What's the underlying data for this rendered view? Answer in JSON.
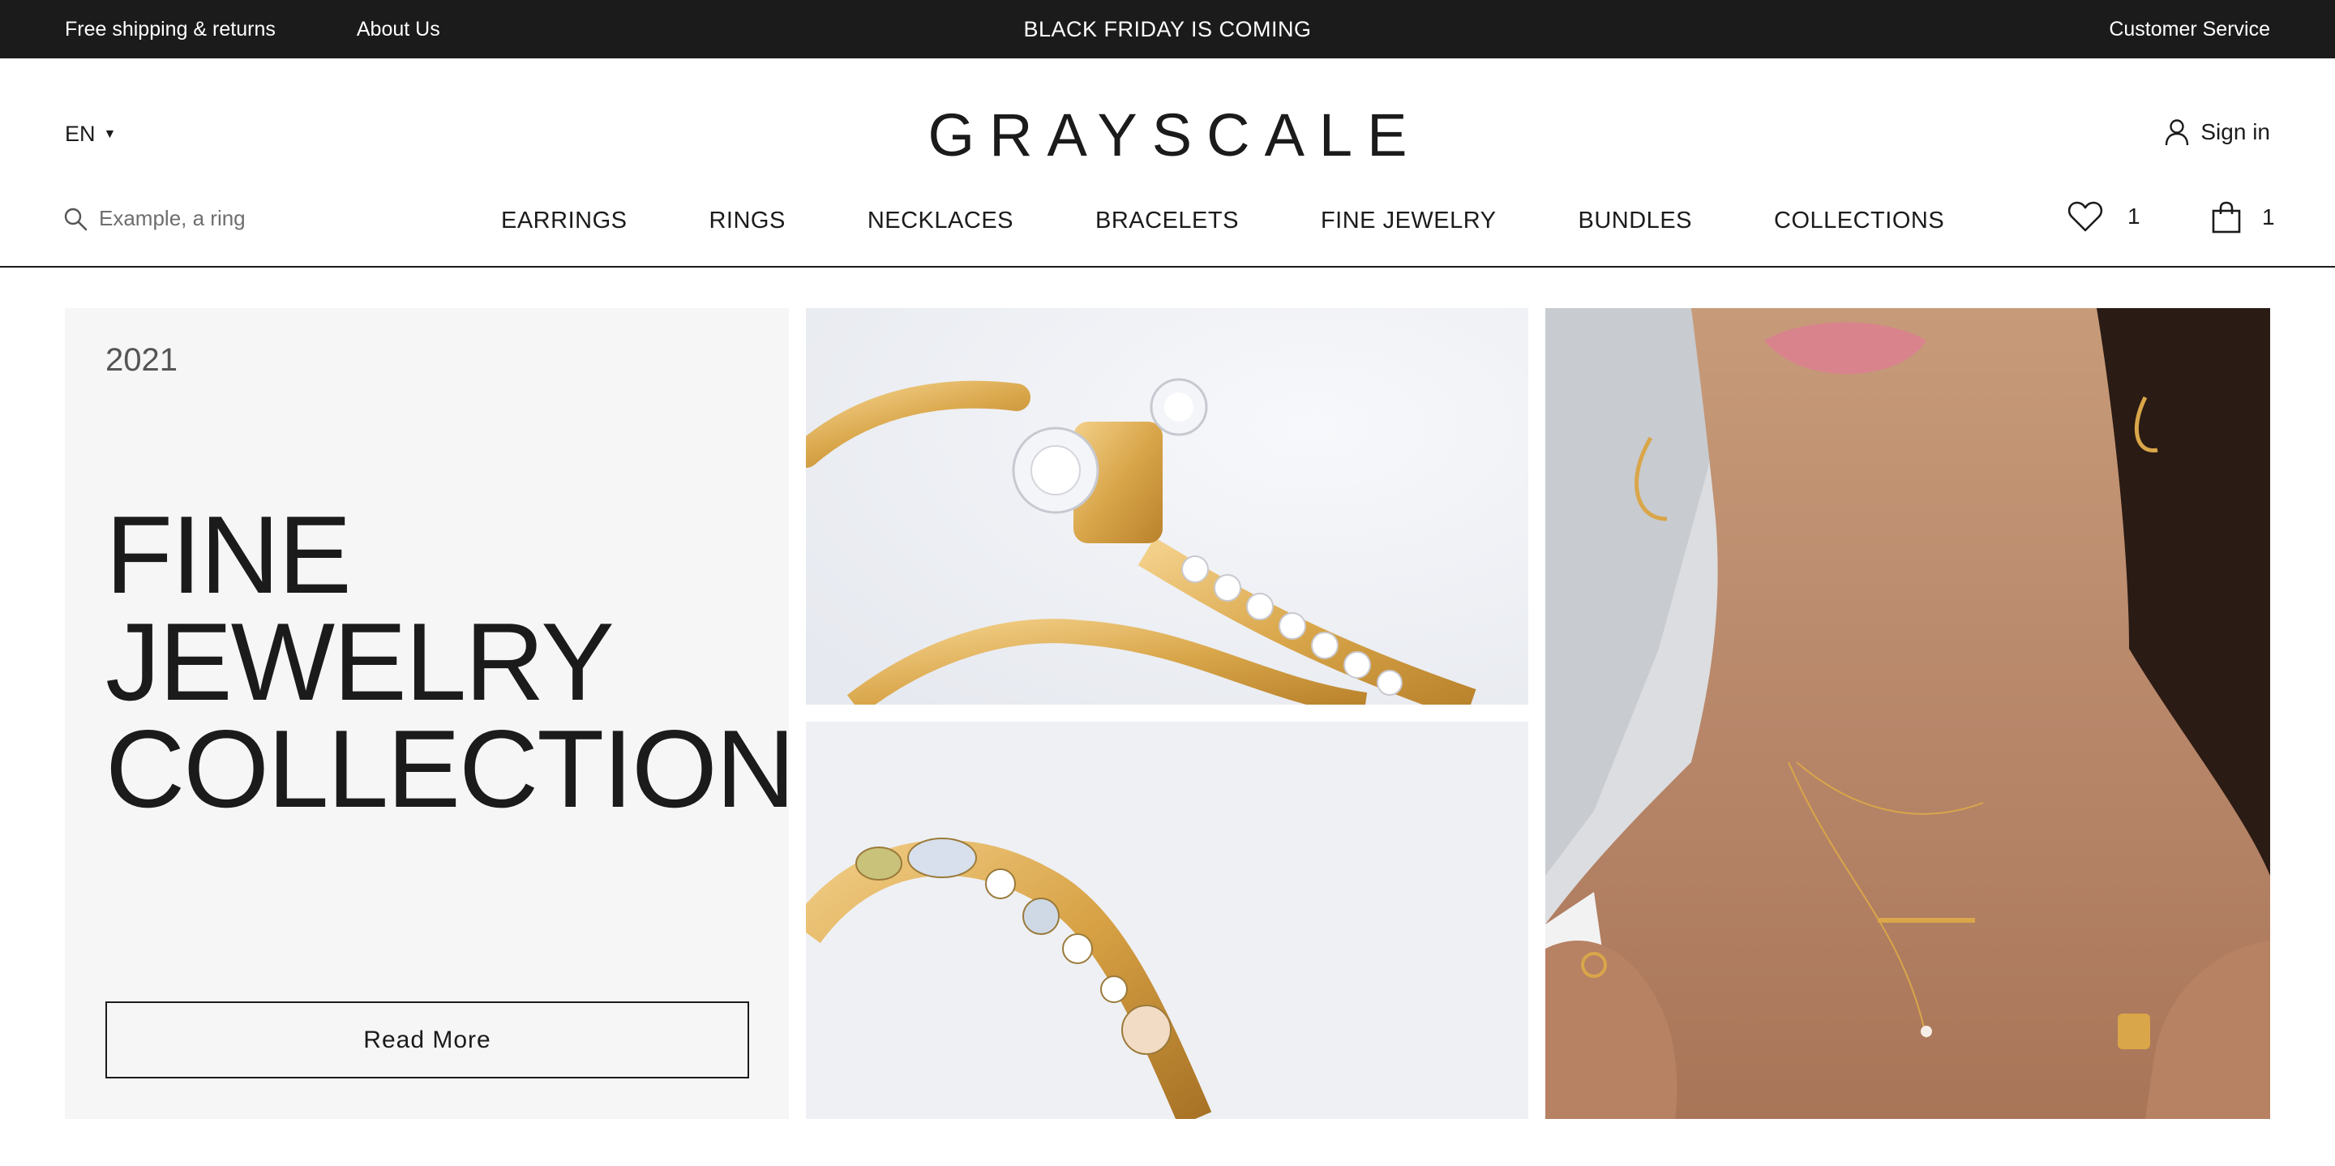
{
  "topbar": {
    "shipping": "Free shipping & returns",
    "about": "About Us",
    "announcement": "BLACK FRIDAY IS COMING",
    "customer_service": "Customer Service"
  },
  "header": {
    "language": "EN",
    "logo": "GRAYSCALE",
    "sign_in": "Sign in",
    "search_placeholder": "Example, a ring",
    "nav": [
      "EARRINGS",
      "RINGS",
      "NECKLACES",
      "BRACELETS",
      "FINE JEWELRY",
      "BUNDLES",
      "COLLECTIONS"
    ],
    "wishlist_count": "1",
    "cart_count": "1"
  },
  "hero": {
    "year": "2021",
    "headline": [
      "FINE",
      "JEWELRY",
      "COLLECTION"
    ],
    "cta": "Read More"
  },
  "icons": {
    "search": "search-icon",
    "user": "user-icon",
    "heart": "heart-icon",
    "bag": "shopping-bag-icon",
    "caret": "caret-down-icon"
  },
  "colors": {
    "topbar_bg": "#1b1b1b",
    "promo_bg": "#f6f6f7",
    "gold": "#d9a64a"
  }
}
